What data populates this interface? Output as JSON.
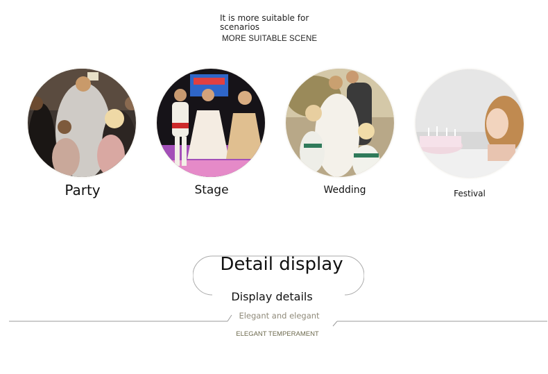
{
  "header": {
    "line1": "It is more suitable for scenarios",
    "line2": "MORE SUITABLE SCENE"
  },
  "scenes": [
    {
      "label": "Party"
    },
    {
      "label": "Stage"
    },
    {
      "label": "Wedding"
    },
    {
      "label": "Festival"
    }
  ],
  "detail": {
    "title": "Detail display",
    "subtitle": "Display details",
    "tagline": "Elegant and elegant",
    "caption": "ELEGANT TEMPERAMENT"
  },
  "colors": {
    "rule": "#9a9a9a",
    "tagline": "#8f8a7a",
    "caption": "#6d6a4e"
  }
}
